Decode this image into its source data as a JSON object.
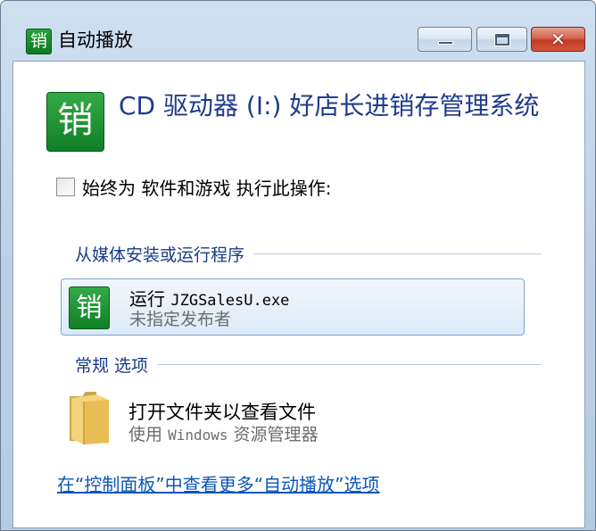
{
  "window": {
    "title": "自动播放",
    "app_icon_char": "销",
    "controls": {
      "minimize_icon": "minimize-icon",
      "maximize_icon": "maximize-icon",
      "close_glyph": "✕"
    }
  },
  "heading": {
    "icon_char": "销",
    "text": "CD 驱动器 (I:) 好店长进销存管理系统"
  },
  "always_checkbox": {
    "label": "始终为 软件和游戏 执行此操作:",
    "checked": false
  },
  "sections": {
    "install": {
      "title": "从媒体安装或运行程序"
    },
    "general": {
      "title": "常规 选项"
    }
  },
  "options": {
    "run": {
      "icon_char": "销",
      "title_prefix": "运行",
      "title_file": "JZGSalesU.exe",
      "subtitle": "未指定发布者"
    },
    "open_folder": {
      "title": "打开文件夹以查看文件",
      "subtitle_prefix": "使用",
      "subtitle_app": "Windows",
      "subtitle_suffix": "资源管理器"
    }
  },
  "footer": {
    "link_text": "在“控制面板”中查看更多“自动播放”选项"
  },
  "colors": {
    "accent_blue": "#1f3b8c",
    "link_blue": "#0b56b8",
    "app_green": "#117f26",
    "close_red": "#c13b24"
  }
}
